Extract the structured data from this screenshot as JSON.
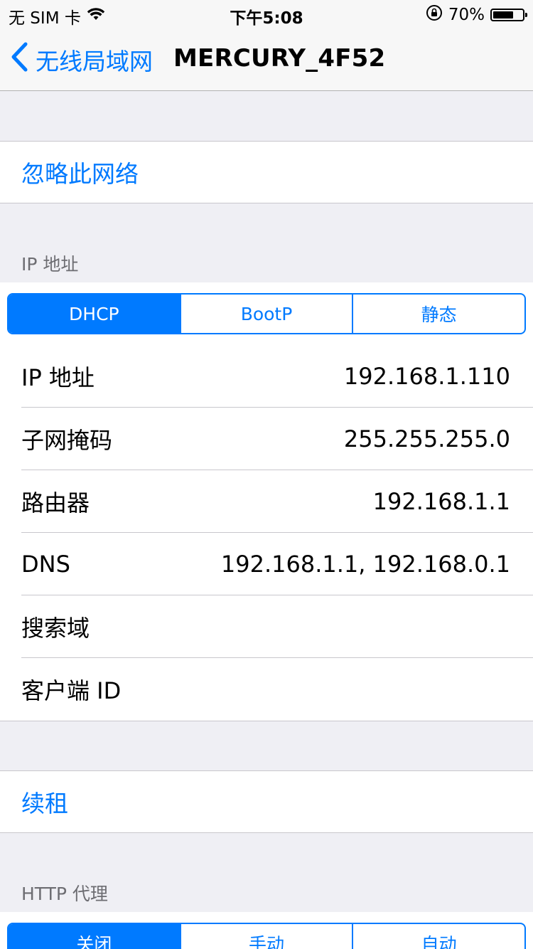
{
  "status_bar": {
    "carrier": "无 SIM 卡",
    "time": "下午5:08",
    "battery_percent_text": "70%",
    "battery_level": 0.7
  },
  "nav": {
    "back_label": "无线局域网",
    "title": "MERCURY_4F52"
  },
  "forget_network": "忽略此网络",
  "ip_section": {
    "header": "IP 地址",
    "modes": [
      "DHCP",
      "BootP",
      "静态"
    ],
    "selected_mode": "DHCP",
    "rows": [
      {
        "label": "IP 地址",
        "value": "192.168.1.110"
      },
      {
        "label": "子网掩码",
        "value": "255.255.255.0"
      },
      {
        "label": "路由器",
        "value": "192.168.1.1"
      },
      {
        "label": "DNS",
        "value": "192.168.1.1, 192.168.0.1"
      },
      {
        "label": "搜索域",
        "value": ""
      },
      {
        "label": "客户端 ID",
        "value": ""
      }
    ]
  },
  "renew_lease": "续租",
  "http_proxy": {
    "header": "HTTP 代理",
    "modes": [
      "关闭",
      "手动",
      "自动"
    ],
    "selected_mode": "关闭"
  },
  "colors": {
    "accent": "#007aff",
    "background": "#efeff4",
    "separator": "#c8c7cc",
    "section_header": "#6d6d72"
  }
}
